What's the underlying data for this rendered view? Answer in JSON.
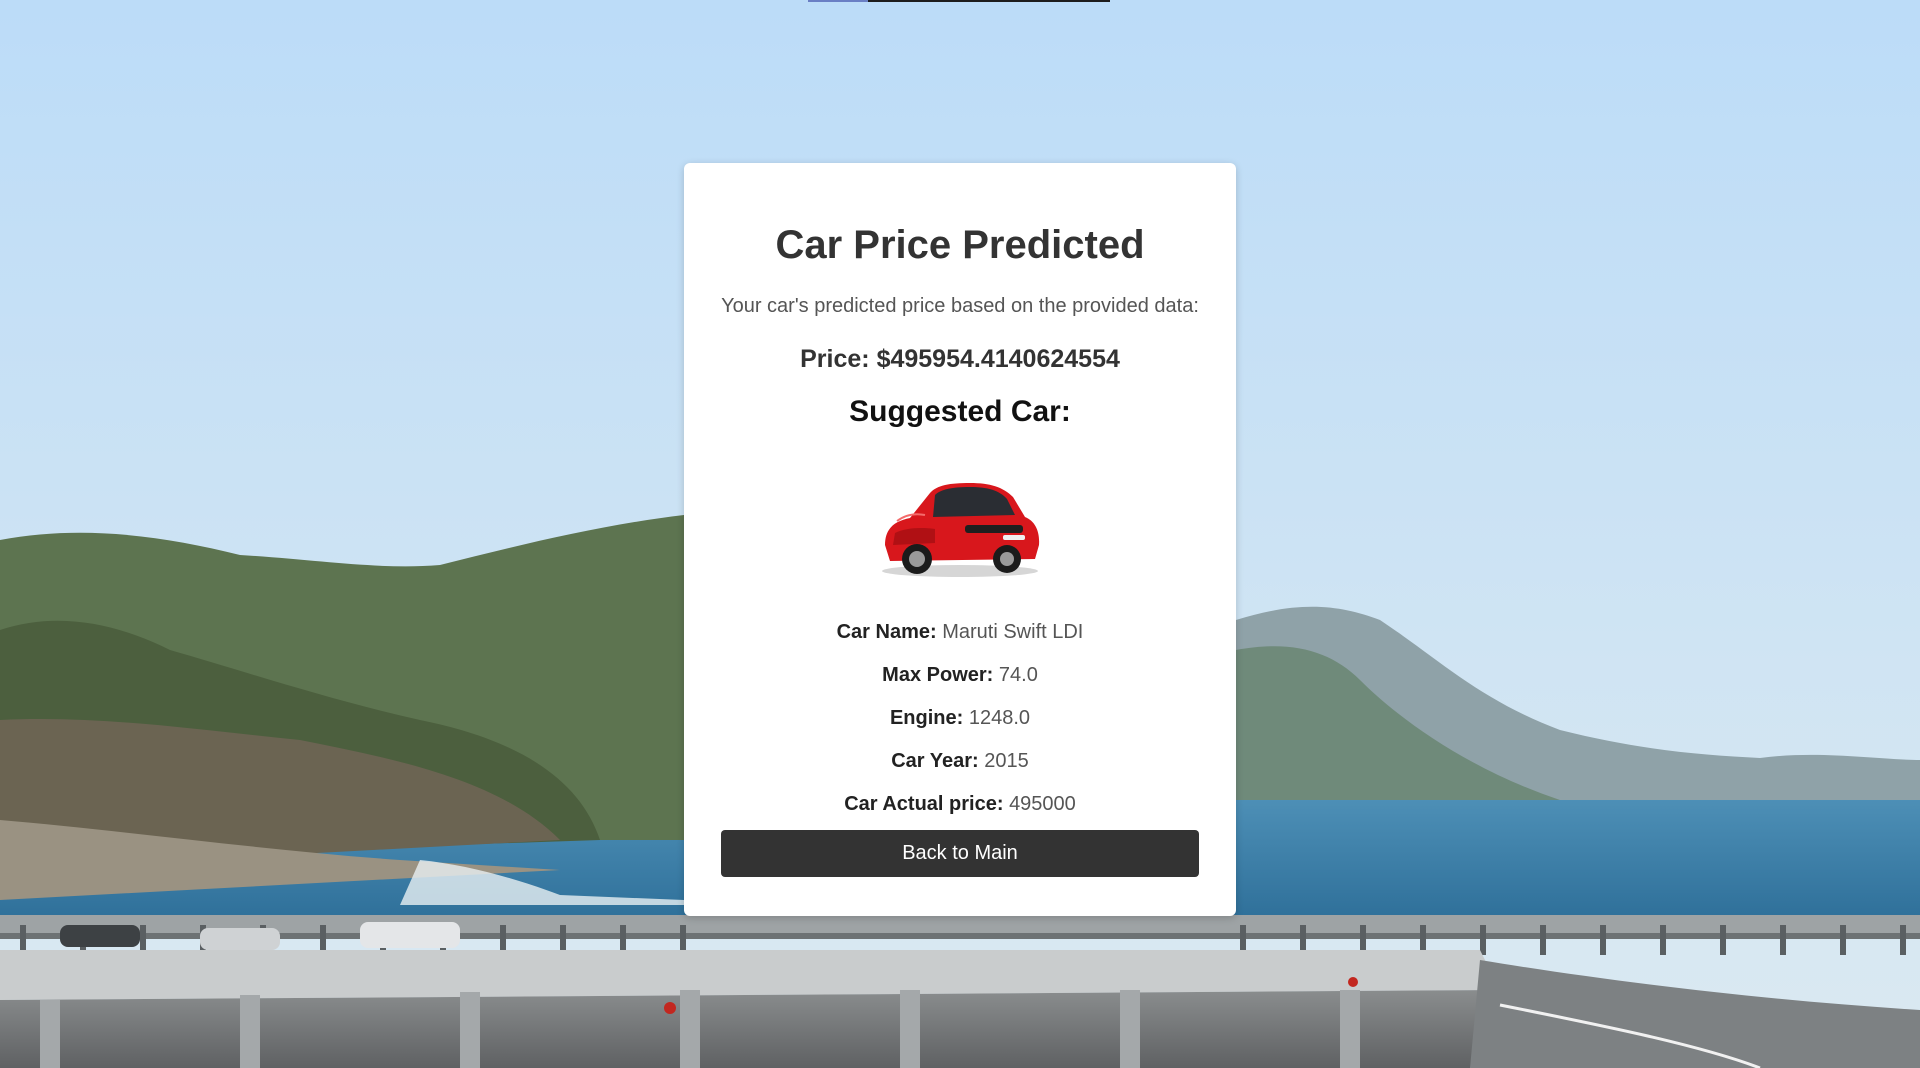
{
  "card": {
    "title": "Car Price Predicted",
    "subtitle": "Your car's predicted price based on the provided data:",
    "price_label": "Price:",
    "price_value": "$495954.4140624554",
    "suggested_heading": "Suggested Car:",
    "car_image_icon": "red-hatchback-car-image",
    "details": {
      "name_label": "Car Name:",
      "name_value": "Maruti Swift LDI",
      "power_label": "Max Power:",
      "power_value": "74.0",
      "engine_label": "Engine:",
      "engine_value": "1248.0",
      "year_label": "Car Year:",
      "year_value": "2015",
      "actual_price_label": "Car Actual price:",
      "actual_price_value": "495000"
    },
    "back_button_label": "Back to Main"
  },
  "colors": {
    "button_bg": "#333333",
    "card_bg": "#ffffff",
    "car_red": "#d8171c"
  }
}
